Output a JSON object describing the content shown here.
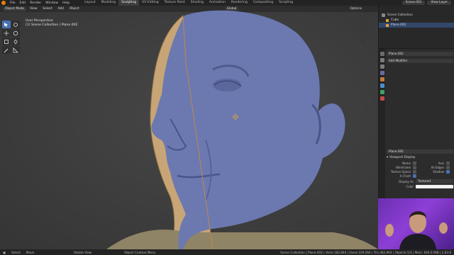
{
  "topbar": {
    "menus": [
      "File",
      "Edit",
      "Render",
      "Window",
      "Help"
    ],
    "workspaces": [
      "Layout",
      "Modeling",
      "Sculpting",
      "UV Editing",
      "Texture Paint",
      "Shading",
      "Animation",
      "Rendering",
      "Compositing",
      "Scripting"
    ],
    "active_workspace": "Sculpting",
    "scene": "Scene.001",
    "view_layer": "View Layer"
  },
  "viewport": {
    "mode": "Object Mode",
    "menus": [
      "View",
      "Select",
      "Add",
      "Object"
    ],
    "orientation": "Global",
    "options_label": "Options",
    "overlay_line1": "User Perspective",
    "overlay_line2": "(1) Scene Collection | Plane.002"
  },
  "outliner": {
    "root": "Scene Collection",
    "items": [
      "Cube",
      "Plane.002"
    ]
  },
  "properties": {
    "object_name": "Plane.002",
    "add_modifier": "Add Modifier",
    "object_name2": "Plane.002",
    "panel_title": "Viewport Display",
    "checks": [
      {
        "left": "Name",
        "left_on": false,
        "right": "Axis",
        "right_on": false
      },
      {
        "left": "Wireframe",
        "left_on": false,
        "right": "All Edges",
        "right_on": false
      },
      {
        "left": "Texture Space",
        "left_on": false,
        "right": "Shadow",
        "right_on": true
      },
      {
        "left": "In Front",
        "left_on": true,
        "right": "",
        "right_on": false
      }
    ],
    "display_as_label": "Display As",
    "display_as_value": "Textured",
    "color_label": "Color"
  },
  "statusbar": {
    "left": [
      "Select",
      "Move",
      "Rotate View",
      "Object Context Menu"
    ],
    "right": "Scene Collection | Plane.002 | Verts:182,844 | Faces:319,564 | Tris:362,964 | Objects:1/3 | Mem: 644.6 MiB | 2.83.6"
  },
  "colors": {
    "accent": "#4772b3",
    "sculpt_blue": "#6b79b0",
    "sculpt_tan": "#c8a576",
    "brand_orange": "#e87d0d"
  }
}
